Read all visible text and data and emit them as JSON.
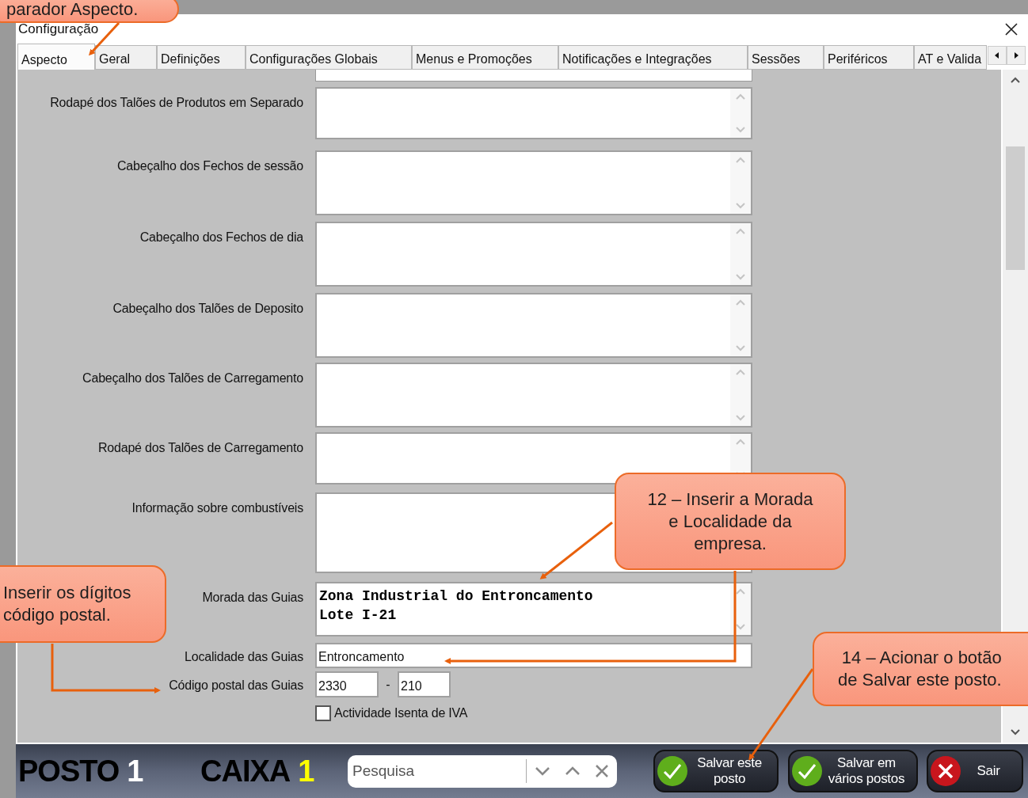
{
  "window": {
    "title": "Configuração"
  },
  "tabs": [
    {
      "label": "Aspecto",
      "selected": true
    },
    {
      "label": "Geral",
      "selected": false
    },
    {
      "label": "Definições",
      "selected": false
    },
    {
      "label": "Configurações Globais",
      "selected": false
    },
    {
      "label": "Menus e Promoções",
      "selected": false
    },
    {
      "label": "Notificações e Integrações",
      "selected": false
    },
    {
      "label": "Sessões",
      "selected": false
    },
    {
      "label": "Periféricos",
      "selected": false
    },
    {
      "label": "AT e Valida",
      "selected": false
    }
  ],
  "form": [
    {
      "kind": "textarea",
      "label": "Rodapé dos Talões de Produtos em Separado"
    },
    {
      "kind": "textarea",
      "label": "Cabeçalho dos Fechos de sessão"
    },
    {
      "kind": "textarea",
      "label": "Cabeçalho dos Fechos de dia"
    },
    {
      "kind": "textarea",
      "label": "Cabeçalho dos Talões de Deposito"
    },
    {
      "kind": "textarea",
      "label": "Cabeçalho dos Talões de Carregamento"
    },
    {
      "kind": "textarea",
      "label": "Rodapé dos Talões de Carregamento"
    },
    {
      "kind": "textarea",
      "label": "Informação sobre combustíveis"
    },
    {
      "kind": "textarea",
      "label": "Morada das Guias",
      "lines": [
        "Zona Industrial do Entroncamento",
        "Lote I-21"
      ]
    },
    {
      "kind": "input",
      "label": "Localidade das Guias",
      "value": "Entroncamento"
    },
    {
      "kind": "postal",
      "label": "Código postal das Guias",
      "first": "2330",
      "separator": "-",
      "second": "210"
    },
    {
      "kind": "checkbox",
      "label": "Actividade Isenta de IVA",
      "checked": false
    }
  ],
  "status_bar": {
    "counters": [
      {
        "label": "POSTO",
        "number": "1",
        "color": "#ffffff"
      },
      {
        "label": "CAIXA",
        "number": "1",
        "color": "#ffff00"
      }
    ],
    "search": {
      "placeholder": "Pesquisa"
    },
    "buttons": [
      {
        "kind": "confirm",
        "lines": [
          "Salvar este",
          "posto"
        ]
      },
      {
        "kind": "confirm",
        "lines": [
          "Salvar em",
          "vários postos"
        ]
      },
      {
        "kind": "cancel",
        "lines": [
          "Sair"
        ]
      }
    ]
  },
  "callouts": [
    {
      "text": "parador Aspecto."
    },
    {
      "text": "Inserir os dígitos\ncódigo postal."
    },
    {
      "text": "12 – Inserir a Morada\ne Localidade da\nempresa."
    },
    {
      "text": "14 – Acionar o botão\nde Salvar este posto."
    }
  ]
}
